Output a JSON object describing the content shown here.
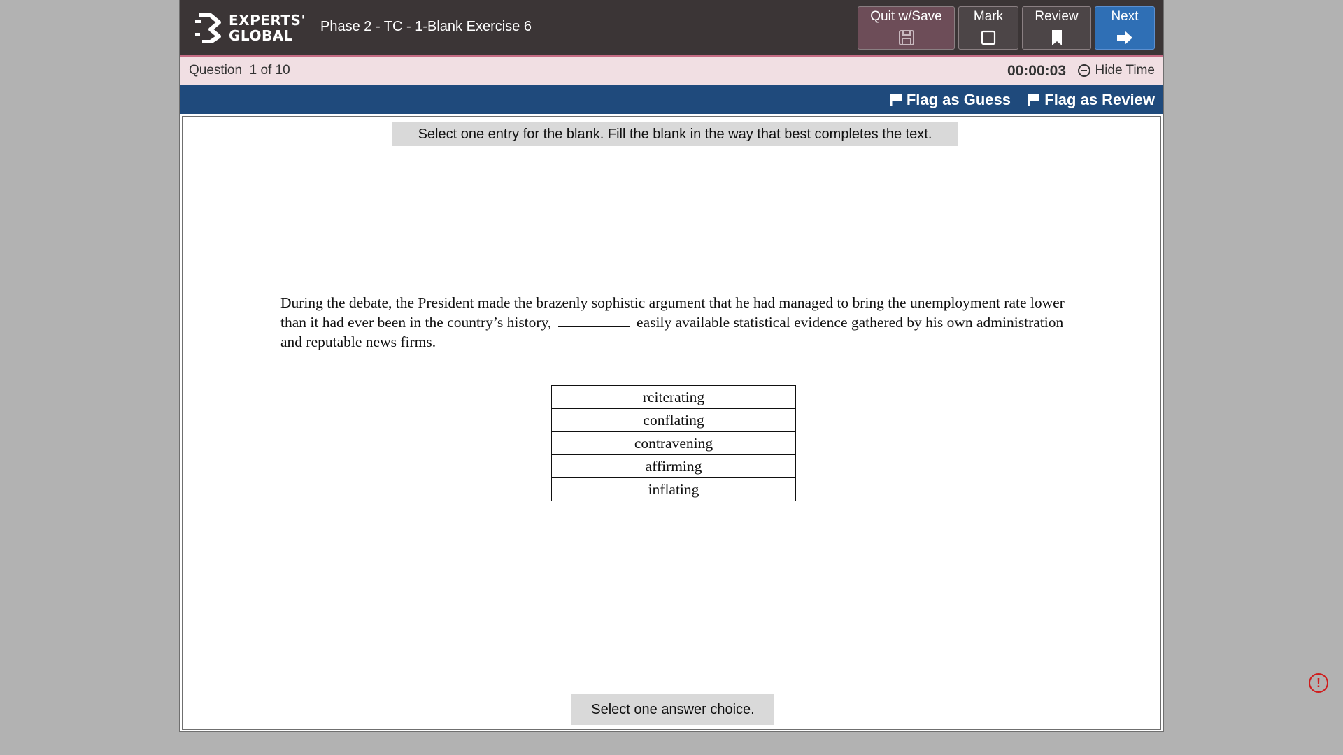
{
  "header": {
    "logo_line1": "EXPERTS'",
    "logo_line2": "GLOBAL",
    "title": "Phase 2 - TC - 1-Blank Exercise 6",
    "buttons": {
      "quit": "Quit w/Save",
      "mark": "Mark",
      "review": "Review",
      "next": "Next"
    }
  },
  "subbar": {
    "question_count": "Question  1 of 10",
    "timer": "00:00:03",
    "hide_time": "Hide Time"
  },
  "flags": {
    "guess": "Flag as Guess",
    "review": "Flag as Review"
  },
  "main": {
    "instruction": "Select one entry for the blank. Fill the blank in the way that best completes the text.",
    "question_before": "During the debate, the President made the brazenly sophistic argument that he had managed to bring the unemployment rate lower than it had ever been in the country’s history,",
    "question_after": "easily available statistical evidence gathered by his own administration and reputable news firms.",
    "choices": [
      "reiterating",
      "conflating",
      "contravening",
      "affirming",
      "inflating"
    ],
    "footer_note": "Select one answer choice."
  },
  "alert": {
    "symbol": "!"
  },
  "colors": {
    "header_bg": "#3b3536",
    "subbar_bg": "#f1dfe3",
    "flagbar_bg": "#1f4a7c",
    "next_button": "#2f6fb5",
    "quit_button": "#6d4d58",
    "alert": "#d01c1c"
  },
  "icons": {
    "quit": "floppy-disk-icon",
    "mark": "checkbox-icon",
    "review": "bookmark-icon",
    "next": "arrow-right-icon",
    "flag": "flag-icon",
    "hide_time": "minus-circle-icon",
    "alert": "exclamation-circle-icon"
  }
}
